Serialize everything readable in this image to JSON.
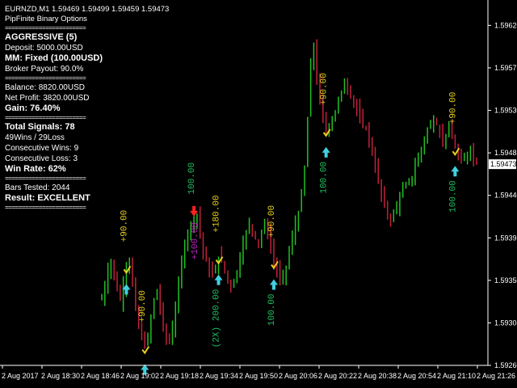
{
  "header": {
    "symbol_line": "EURNZD,M1  1.59469 1.59499 1.59459 1.59473",
    "indicator_name": "PipFinite Binary Options"
  },
  "panel": {
    "separator": "========================",
    "mode": "AGGRESSIVE (5)",
    "deposit": "Deposit: 5000.00USD",
    "mm": "MM: Fixed (100.00USD)",
    "payout": "Broker Payout: 90.0%",
    "balance": "Balance: 8820.00USD",
    "net_profit": "Net Profit: 3820.00USD",
    "gain": "Gain: 76.40%",
    "total_signals": "Total Signals: 78",
    "wins_losses": "49Wins / 29Loss",
    "consec_wins": "Consecutive Wins: 9",
    "consec_loss": "Consecutive Loss: 3",
    "win_rate": "Win Rate: 62%",
    "bars_tested": "Bars Tested: 2044",
    "result": "Result: EXCELLENT"
  },
  "colors": {
    "background": "#000000",
    "bull_candle": "#22c022",
    "bear_candle": "#c0213a",
    "buy_arrow": "#40d0e0",
    "sell_arrow": "#ff2020",
    "win_text": "#e8d020",
    "loss_text": "#20c060",
    "martingale_text": "#c020c0",
    "axis": "#ffffff",
    "price_marker_bg": "#ffffff"
  },
  "chart_data": {
    "type": "candlestick",
    "ylim": [
      1.5926,
      1.5964
    ],
    "y_ticks": [
      "1.59620",
      "1.59575",
      "1.59530",
      "1.59485",
      "1.59440",
      "1.59395",
      "1.59350",
      "1.59305",
      "1.59260"
    ],
    "x_ticks": [
      "2 Aug 2017",
      "2 Aug 18:30",
      "2 Aug 18:46",
      "2 Aug 19:02",
      "2 Aug 19:18",
      "2 Aug 19:34",
      "2 Aug 19:50",
      "2 Aug 20:06",
      "2 Aug 20:22",
      "2 Aug 20:38",
      "2 Aug 20:54",
      "2 Aug 21:10",
      "2 Aug 21:26"
    ],
    "current_price": "1.59473",
    "price_path": [
      1.5933,
      1.59345,
      1.5936,
      1.5937,
      1.59355,
      1.5934,
      1.5933,
      1.59345,
      1.59365,
      1.5937,
      1.59345,
      1.5932,
      1.593,
      1.5929,
      1.5928,
      1.5929,
      1.5931,
      1.5933,
      1.5934,
      1.5932,
      1.593,
      1.5929,
      1.59285,
      1.593,
      1.5932,
      1.59345,
      1.5937,
      1.5939,
      1.594,
      1.5941,
      1.59415,
      1.5942,
      1.594,
      1.5938,
      1.5937,
      1.5936,
      1.59355,
      1.59365,
      1.59375,
      1.5937,
      1.5936,
      1.5935,
      1.59345,
      1.5935,
      1.5936,
      1.59375,
      1.5939,
      1.594,
      1.5941,
      1.59405,
      1.59395,
      1.5939,
      1.594,
      1.5941,
      1.594,
      1.59385,
      1.5937,
      1.5936,
      1.5935,
      1.59355,
      1.59365,
      1.5938,
      1.59395,
      1.5941,
      1.5942,
      1.5944,
      1.5947,
      1.5952,
      1.5958,
      1.596,
      1.5956,
      1.5954,
      1.5952,
      1.5951,
      1.59515,
      1.5952,
      1.5953,
      1.5954,
      1.5955,
      1.5956,
      1.59555,
      1.59545,
      1.5954,
      1.5953,
      1.5952,
      1.59515,
      1.5951,
      1.595,
      1.59485,
      1.5947,
      1.59455,
      1.5944,
      1.5943,
      1.5942,
      1.59415,
      1.5942,
      1.5943,
      1.5944,
      1.59445,
      1.5945,
      1.59455,
      1.5946,
      1.5947,
      1.5948,
      1.5949,
      1.595,
      1.5951,
      1.59515,
      1.5952,
      1.59515,
      1.59505,
      1.595,
      1.59505,
      1.5951,
      1.595,
      1.5949,
      1.5948,
      1.59475,
      1.59478,
      1.59485,
      1.5949,
      1.5948,
      1.59473
    ],
    "signals": [
      {
        "bar": 8,
        "label": "+90.00",
        "color": "win",
        "dir": "buy"
      },
      {
        "bar": 14,
        "label": "+90.00",
        "color": "win",
        "dir": "buy"
      },
      {
        "bar": 30,
        "label": "100.00",
        "color": "loss",
        "dir": "sell"
      },
      {
        "bar": 31,
        "label": "+100.00",
        "color": "martingale",
        "dir": "buy"
      },
      {
        "bar": 38,
        "label": "+180.00",
        "color": "win",
        "dir": "buy"
      },
      {
        "bar": 38,
        "label": "(2X) 200.00",
        "color": "loss",
        "dir": "buy"
      },
      {
        "bar": 56,
        "label": "+90.00",
        "color": "win",
        "dir": "buy"
      },
      {
        "bar": 56,
        "label": "100.00",
        "color": "loss",
        "dir": "buy"
      },
      {
        "bar": 73,
        "label": "+90.00",
        "color": "win",
        "dir": "buy"
      },
      {
        "bar": 73,
        "label": "100.00",
        "color": "loss",
        "dir": "buy"
      },
      {
        "bar": 115,
        "label": "+90.00",
        "color": "win",
        "dir": "buy"
      },
      {
        "bar": 115,
        "label": "100.00",
        "color": "loss",
        "dir": "buy"
      }
    ]
  }
}
